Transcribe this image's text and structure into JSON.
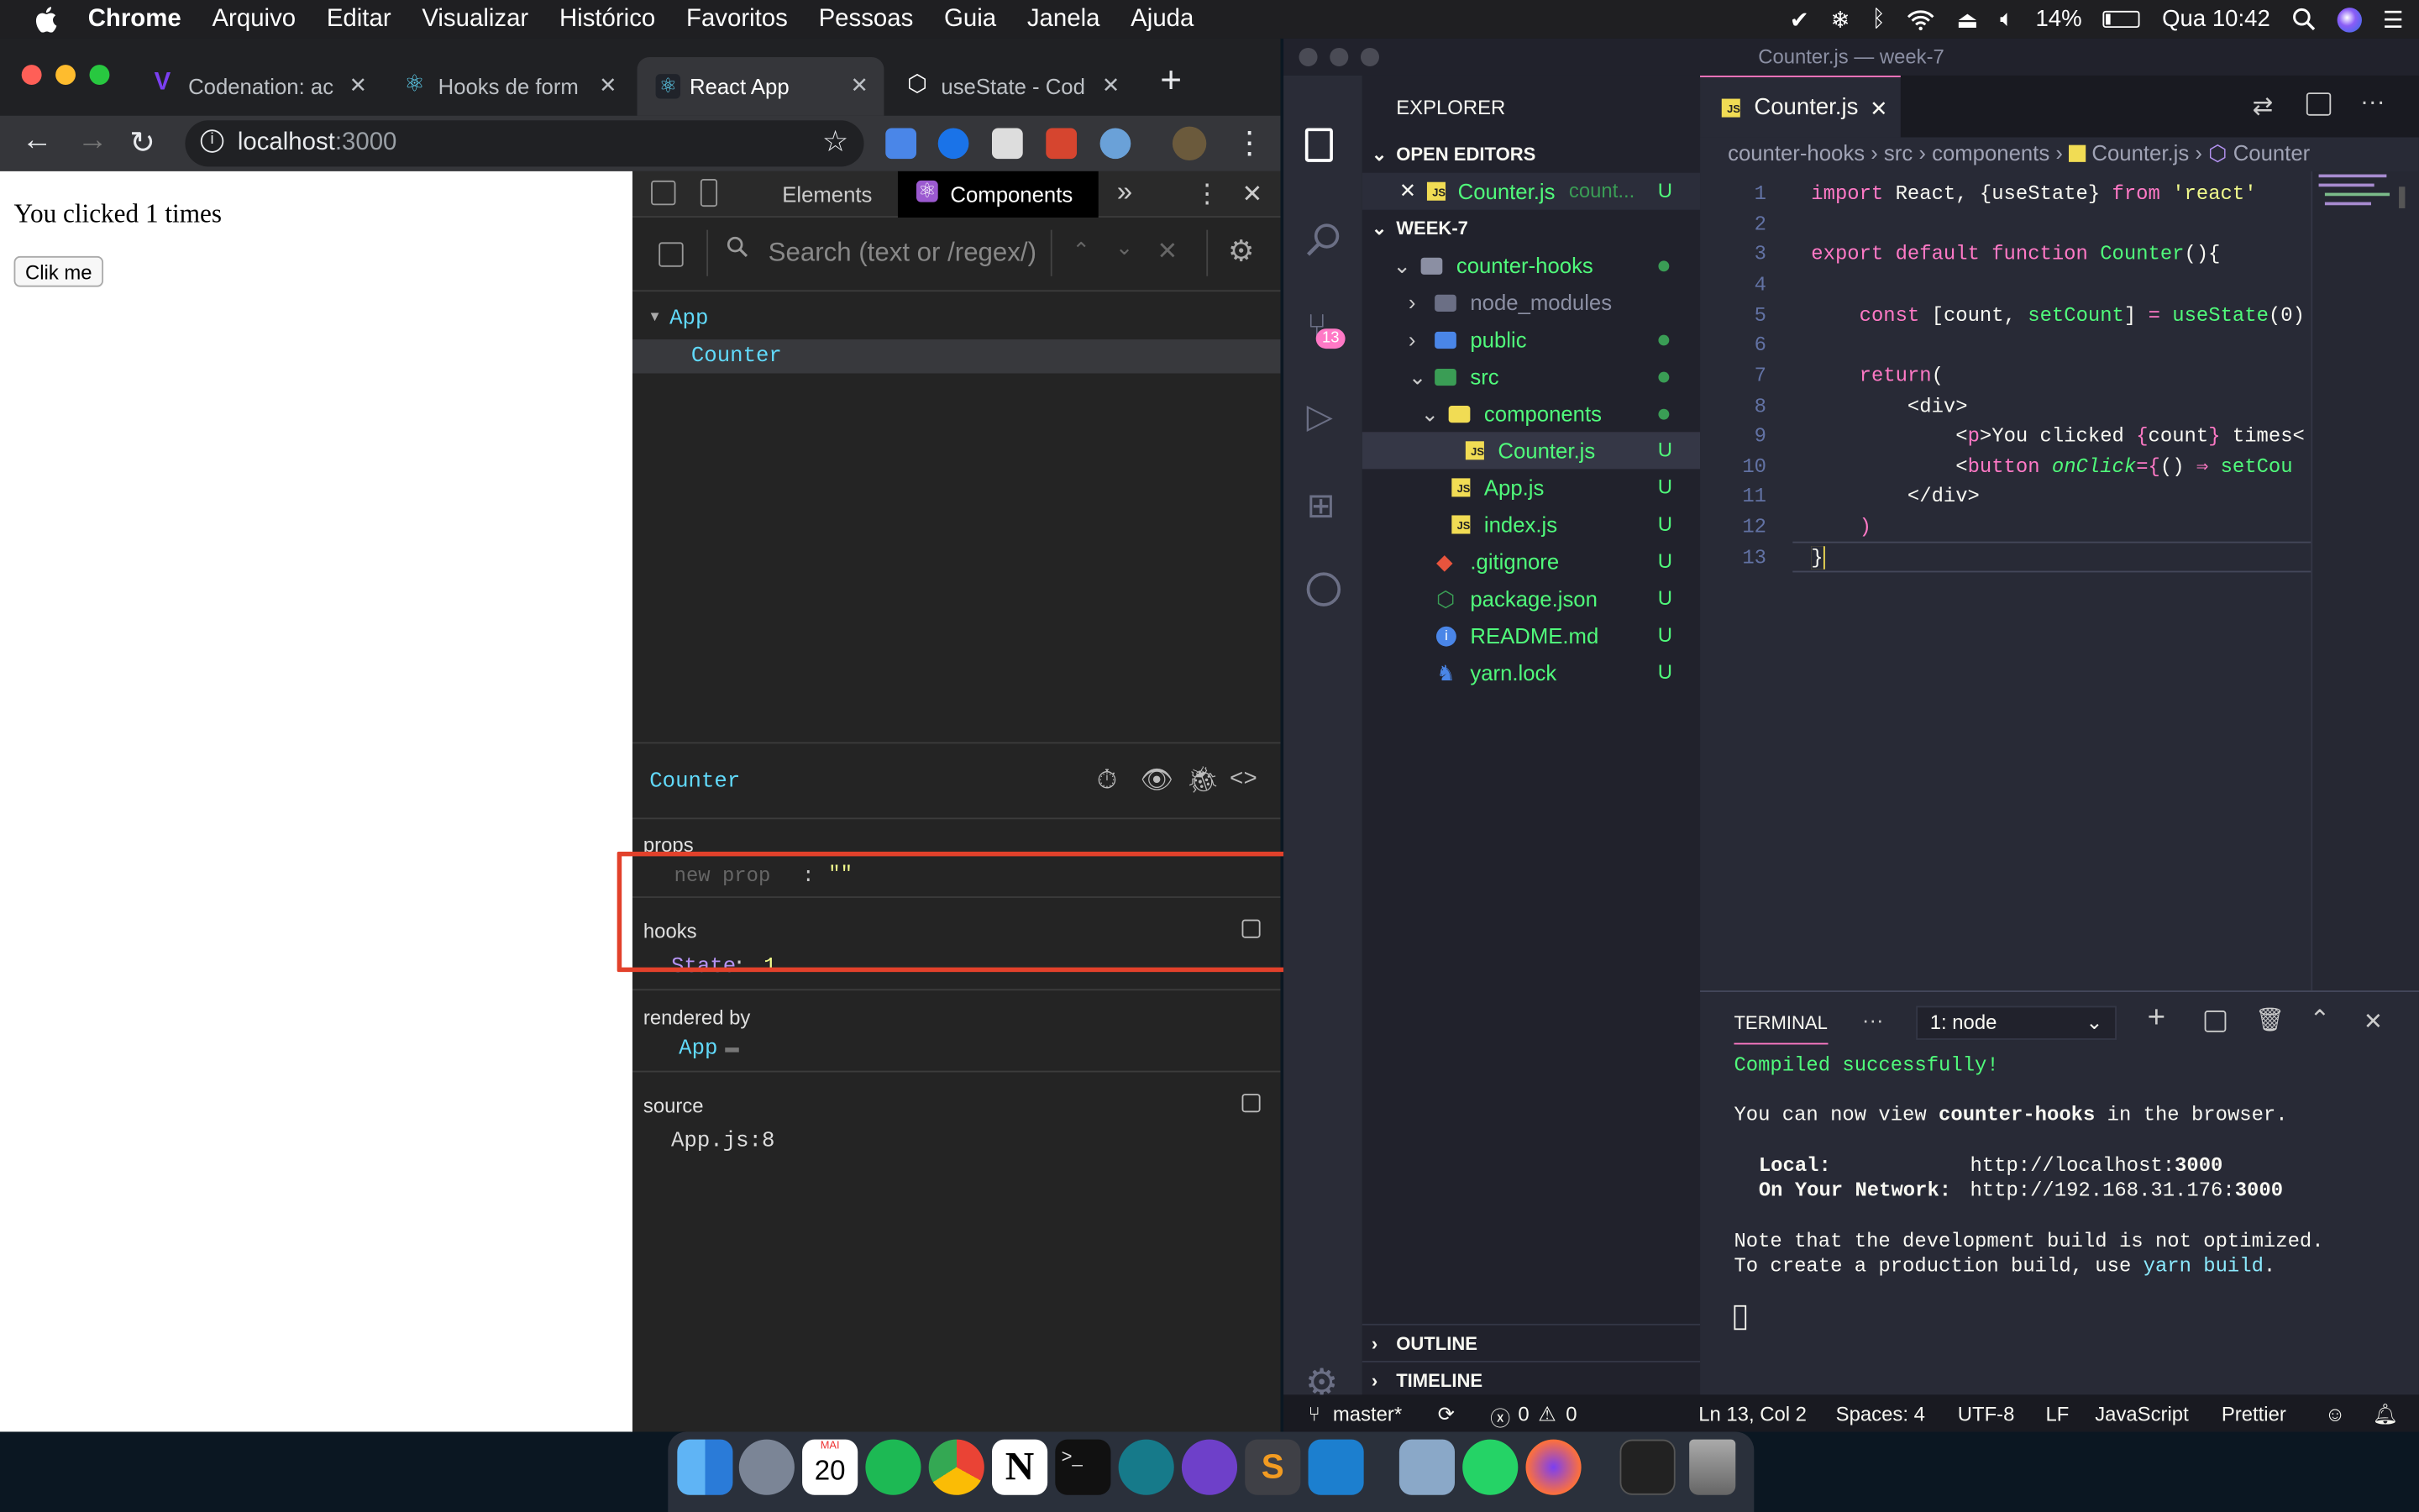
{
  "menubar": {
    "apple": "",
    "items": [
      "Chrome",
      "Arquivo",
      "Editar",
      "Visualizar",
      "Histórico",
      "Favoritos",
      "Pessoas",
      "Guia",
      "Janela",
      "Ajuda"
    ],
    "battery": "14%",
    "clock": "Qua 10:42"
  },
  "chrome": {
    "tabs": [
      {
        "label": "Codenation: ac",
        "icon_color": "#7b3ff2"
      },
      {
        "label": "Hooks de form",
        "icon_color": "#61dafb"
      },
      {
        "label": "React App",
        "icon_color": "#61dafb"
      },
      {
        "label": "useState - Cod",
        "icon_color": "#ffffff"
      }
    ],
    "new_tab": "+",
    "url_host": "localhost",
    "url_port": ":3000"
  },
  "webpage": {
    "text": "You clicked 1 times",
    "button": "Clik me"
  },
  "devtools": {
    "tabs": {
      "elements": "Elements",
      "components": "Components",
      "more": "»"
    },
    "search_placeholder": "Search (text or /regex/)",
    "tree": {
      "root": "App",
      "child": "Counter"
    },
    "selected": "Counter",
    "props_label": "props",
    "new_prop": "new prop",
    "new_prop_colon": ":",
    "new_prop_value": "\"\"",
    "hooks_label": "hooks",
    "state_key": "State",
    "state_colon": ":",
    "state_value": "1",
    "rendered_by_label": "rendered by",
    "rendered_by": "App",
    "source_label": "source",
    "source_value": "App.js:8"
  },
  "vscode": {
    "title": "Counter.js — week-7",
    "explorer_label": "EXPLORER",
    "open_editors_label": "OPEN EDITORS",
    "open_editor_file": "Counter.js",
    "open_editor_path": "count...",
    "open_editor_status": "U",
    "workspace": "WEEK-7",
    "files": [
      {
        "name": "counter-hooks",
        "status": ""
      },
      {
        "name": "node_modules",
        "status": ""
      },
      {
        "name": "public",
        "status": ""
      },
      {
        "name": "src",
        "status": ""
      },
      {
        "name": "components",
        "status": ""
      },
      {
        "name": "Counter.js",
        "status": "U"
      },
      {
        "name": "App.js",
        "status": "U"
      },
      {
        "name": "index.js",
        "status": "U"
      },
      {
        "name": ".gitignore",
        "status": "U"
      },
      {
        "name": "package.json",
        "status": "U"
      },
      {
        "name": "README.md",
        "status": "U"
      },
      {
        "name": "yarn.lock",
        "status": "U"
      }
    ],
    "outline": "OUTLINE",
    "timeline": "TIMELINE",
    "scm_badge": "13",
    "editor_tab": "Counter.js",
    "breadcrumb": [
      "counter-hooks",
      "src",
      "components",
      "Counter.js",
      "Counter"
    ],
    "line_numbers": [
      "1",
      "2",
      "3",
      "4",
      "5",
      "6",
      "7",
      "8",
      "9",
      "10",
      "11",
      "12",
      "13"
    ],
    "terminal": {
      "tab": "TERMINAL",
      "more": "···",
      "select": "1: node",
      "compiled": "Compiled successfully!",
      "view_pre": "You can now view ",
      "view_app": "counter-hooks",
      "view_post": " in the browser.",
      "local_label": "Local:",
      "local_url": "http://localhost:",
      "local_port": "3000",
      "network_label": "On Your Network:",
      "network_url": "http://192.168.31.176:",
      "network_port": "3000",
      "note1": "Note that the development build is not optimized.",
      "note2_pre": "To create a production build, use ",
      "note2_cmd": "yarn build",
      "note2_post": "."
    },
    "status": {
      "branch": "master*",
      "errors": "0",
      "warnings": "0",
      "position": "Ln 13, Col 2",
      "spaces": "Spaces: 4",
      "encoding": "UTF-8",
      "eol": "LF",
      "language": "JavaScript",
      "formatter": "Prettier"
    }
  },
  "dock": {
    "calendar_month": "MAI",
    "calendar_day": "20",
    "apps": [
      "finder-icon",
      "launchpad-icon",
      "calendar-icon",
      "spotify-icon",
      "chrome-icon",
      "notion-icon",
      "terminal-icon",
      "gitkraken-icon",
      "github-desktop-icon",
      "sublime-icon",
      "vscode-icon",
      "preview-icon",
      "whatsapp-icon",
      "firefox-icon",
      "activity-icon",
      "trash-icon"
    ]
  }
}
